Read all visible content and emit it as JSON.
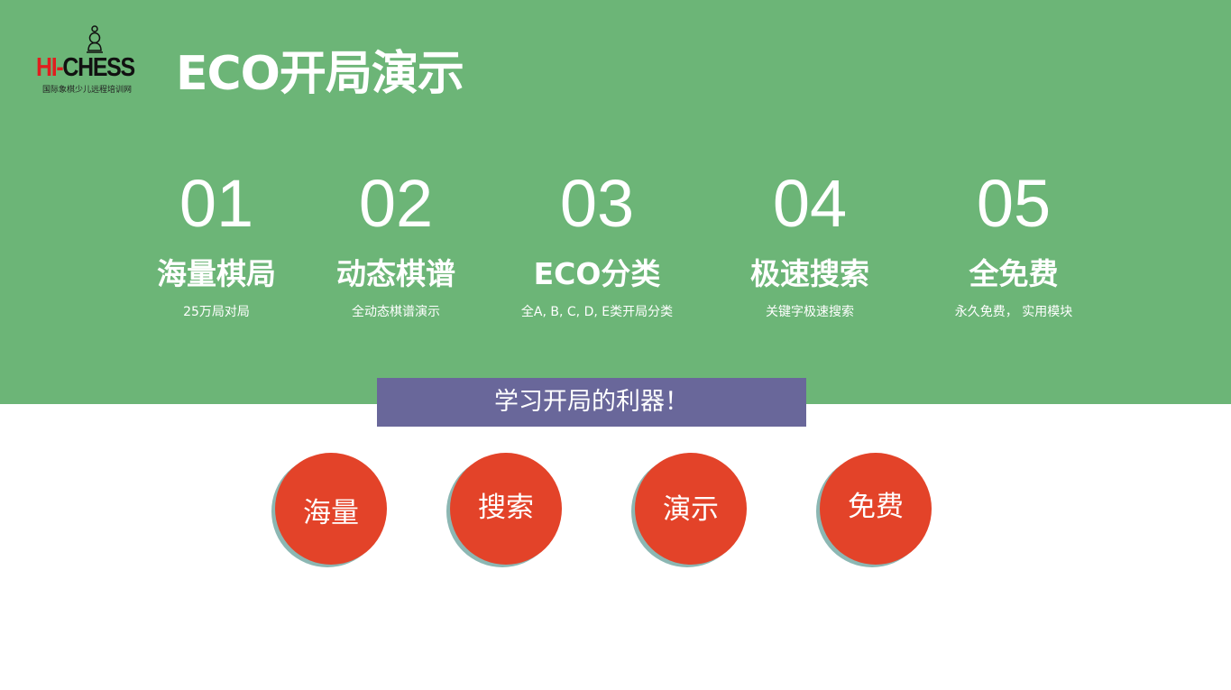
{
  "logo": {
    "brand_hi": "HI-",
    "brand_chess": "CHESS",
    "subtitle": "国际象棋少儿远程培训网",
    "icon": "chess-pawn-icon"
  },
  "title": "ECO开局演示",
  "features": [
    {
      "number": "01",
      "title": "海量棋局",
      "desc": "25万局对局"
    },
    {
      "number": "02",
      "title": "动态棋谱",
      "desc": "全动态棋谱演示"
    },
    {
      "number": "03",
      "title": "ECO分类",
      "desc": "全A, B, C, D, E类开局分类"
    },
    {
      "number": "04",
      "title": "极速搜索",
      "desc": "关键字极速搜索"
    },
    {
      "number": "05",
      "title": "全免费",
      "desc": "永久免费， 实用模块"
    }
  ],
  "banner": "学习开局的利器！",
  "circles": [
    {
      "label": "海量"
    },
    {
      "label": "搜索"
    },
    {
      "label": "演示"
    },
    {
      "label": "免费"
    }
  ],
  "colors": {
    "hero_background": "#6cb577",
    "banner_background": "#69679a",
    "circle_fill": "#e34329",
    "circle_shadow": "#8cb7b3",
    "logo_red": "#e01e1e"
  }
}
